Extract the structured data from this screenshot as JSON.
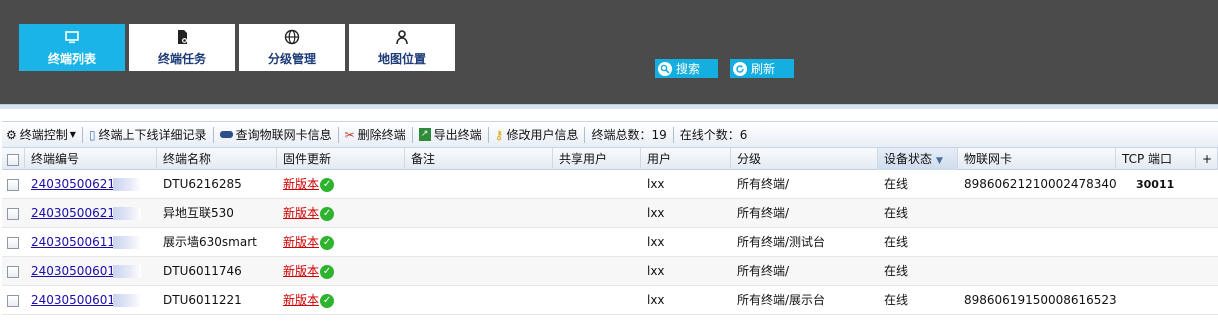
{
  "nav": {
    "tabs": [
      {
        "label": "终端列表",
        "icon": "monitor-icon",
        "active": true
      },
      {
        "label": "终端任务",
        "icon": "task-file-icon",
        "active": false
      },
      {
        "label": "分级管理",
        "icon": "globe-icon",
        "active": false
      },
      {
        "label": "地图位置",
        "icon": "person-icon",
        "active": false
      }
    ]
  },
  "header_buttons": {
    "search_label": "搜索",
    "refresh_label": "刷新"
  },
  "toolbar": {
    "control": "终端控制",
    "log": "终端上下线详细记录",
    "sim_query": "查询物联网卡信息",
    "delete": "删除终端",
    "export": "导出终端",
    "edit_user": "修改用户信息",
    "total": "终端总数：19",
    "online": "在线个数：6"
  },
  "table": {
    "columns": [
      "终端编号",
      "固件更新",
      "终端名称",
      "备注",
      "共享用户",
      "用户",
      "分级",
      "设备状态",
      "物联网卡",
      "TCP 端口"
    ],
    "rows": [
      {
        "id": "24030500621",
        "name": "DTU6216285",
        "fw": "新版本",
        "user": "lxx",
        "grade": "所有终端/",
        "status": "在线",
        "card": "89860621210002478340",
        "tcp": "30011"
      },
      {
        "id": "24030500621",
        "name": "异地互联530",
        "fw": "新版本",
        "user": "lxx",
        "grade": "所有终端/",
        "status": "在线",
        "card": "",
        "tcp": ""
      },
      {
        "id": "24030500611",
        "name": "展示墙630smart",
        "fw": "新版本",
        "user": "lxx",
        "grade": "所有终端/测试台",
        "status": "在线",
        "card": "",
        "tcp": ""
      },
      {
        "id": "24030500601",
        "name": "DTU6011746",
        "fw": "新版本",
        "user": "lxx",
        "grade": "所有终端/",
        "status": "在线",
        "card": "",
        "tcp": ""
      },
      {
        "id": "24030500601",
        "name": "DTU6011221",
        "fw": "新版本",
        "user": "lxx",
        "grade": "所有终端/展示台",
        "status": "在线",
        "card": "89860619150008616523",
        "tcp": ""
      }
    ]
  },
  "colors": {
    "header_bg": "#4b4b4b",
    "active_tab": "#1ab4e8",
    "link": "#1a0dab",
    "firmware_link": "#d00000",
    "ok_icon": "#2db32d"
  }
}
